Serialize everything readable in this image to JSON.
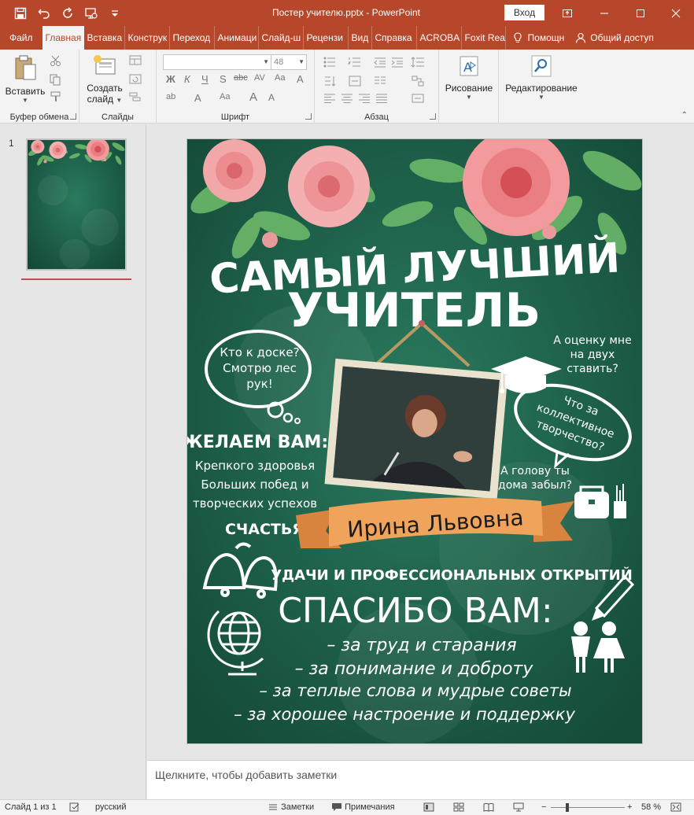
{
  "window": {
    "title": "Постер учителю.pptx  -  PowerPoint",
    "signin": "Вход"
  },
  "tabs": [
    {
      "label": "Файл"
    },
    {
      "label": "Главная"
    },
    {
      "label": "Вставка"
    },
    {
      "label": "Конструк"
    },
    {
      "label": "Переход"
    },
    {
      "label": "Анимаци"
    },
    {
      "label": "Слайд-ш"
    },
    {
      "label": "Рецензи"
    },
    {
      "label": "Вид"
    },
    {
      "label": "Справка"
    },
    {
      "label": "ACROBA"
    },
    {
      "label": "Foxit Rea"
    }
  ],
  "tab_help": "Помощн",
  "tab_share": "Общий доступ",
  "ribbon": {
    "paste": "Вставить",
    "new_slide_1": "Создать",
    "new_slide_2": "слайд",
    "font_size": "48",
    "drawing": "Рисование",
    "editing": "Редактирование",
    "groups": {
      "clipboard": "Буфер обмена",
      "slides": "Слайды",
      "font": "Шрифт",
      "paragraph": "Абзац"
    }
  },
  "thumb_number": "1",
  "notes_placeholder": "Щелкните, чтобы добавить заметки",
  "status": {
    "slide": "Слайд 1 из 1",
    "language": "русский",
    "notes": "Заметки",
    "comments": "Примечания",
    "zoom": "58 %"
  },
  "poster": {
    "title_1": "САМЫЙ ЛУЧШИЙ",
    "title_2": "УЧИТЕЛЬ",
    "bubble_left_1": "Кто к доске?",
    "bubble_left_2": "Смотрю лес",
    "bubble_left_3": "рук!",
    "right_1": "А оценку мне",
    "right_2": "на двух",
    "right_3": "ставить?",
    "bubble_right_1": "Что за",
    "bubble_right_2": "коллективное",
    "bubble_right_3": "творчество?",
    "head_1": "А голову ты",
    "head_2": "дома забыл?",
    "wish_title": "ЖЕЛАЕМ ВАМ:",
    "wish_1": "Крепкого здоровья",
    "wish_2": "Больших побед и",
    "wish_3": "творческих успехов",
    "wish_4": "СЧАСТЬЯ",
    "name": "Ирина Львовна",
    "luck": "УДАЧИ И ПРОФЕССИОНАЛЬНЫХ ОТКРЫТИЙ",
    "thanks": "СПАСИБО ВАМ:",
    "line_1": "– за труд и старания",
    "line_2": "– за понимание и доброту",
    "line_3": "– за теплые слова и мудрые советы",
    "line_4": "– за хорошее настроение и поддержку"
  },
  "colors": {
    "brand": "#b7472a",
    "board": "#1f6b52",
    "ribbon_orange": "#f0a35a"
  }
}
